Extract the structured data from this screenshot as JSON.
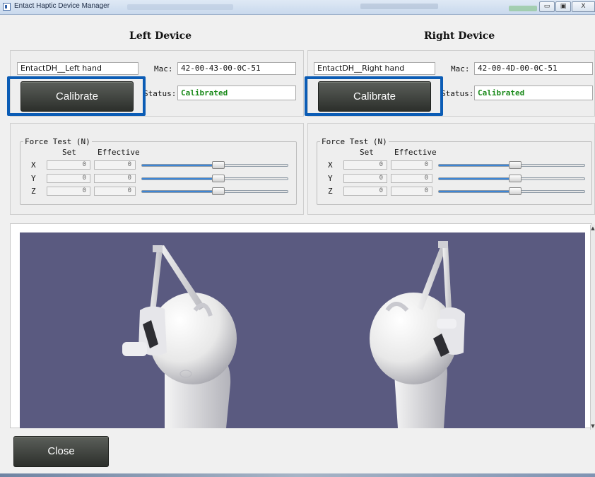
{
  "window": {
    "title": "Entact Haptic Device Manager",
    "minimize_glyph": "▭",
    "maximize_glyph": "▣",
    "close_glyph": "X"
  },
  "left": {
    "header": "Left Device",
    "name": "EntactDH__Left hand",
    "mac_label": "Mac:",
    "mac": "42-00-43-00-0C-51",
    "calibrate_label": "Calibrate",
    "status_label": "Status:",
    "status": "Calibrated",
    "force": {
      "title": "Force Test  (N)",
      "set_label": "Set",
      "effective_label": "Effective",
      "rows": [
        {
          "axis": "X",
          "set": "0",
          "effective": "0",
          "slider": 0.5
        },
        {
          "axis": "Y",
          "set": "0",
          "effective": "0",
          "slider": 0.5
        },
        {
          "axis": "Z",
          "set": "0",
          "effective": "0",
          "slider": 0.5
        }
      ]
    }
  },
  "right": {
    "header": "Right Device",
    "name": "EntactDH__Right hand",
    "mac_label": "Mac:",
    "mac": "42-00-4D-00-0C-51",
    "calibrate_label": "Calibrate",
    "status_label": "Status:",
    "status": "Calibrated",
    "force": {
      "title": "Force Test  (N)",
      "set_label": "Set",
      "effective_label": "Effective",
      "rows": [
        {
          "axis": "X",
          "set": "0",
          "effective": "0",
          "slider": 0.5
        },
        {
          "axis": "Y",
          "set": "0",
          "effective": "0",
          "slider": 0.5
        },
        {
          "axis": "Z",
          "set": "0",
          "effective": "0",
          "slider": 0.5
        }
      ]
    }
  },
  "close_label": "Close",
  "colors": {
    "viewport_bg": "#5a5a80",
    "highlight": "#0b5cb5",
    "status_ok": "#1a8a1a"
  }
}
